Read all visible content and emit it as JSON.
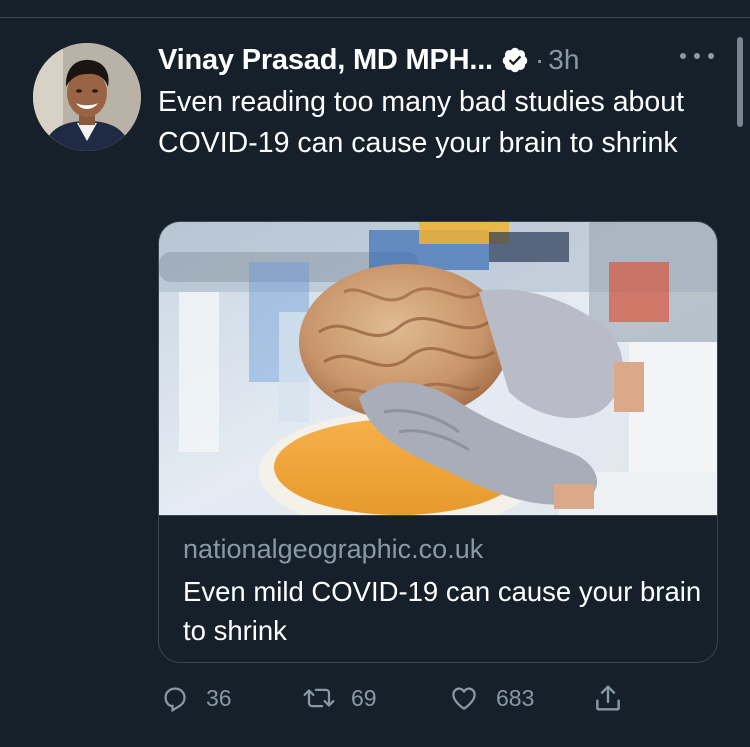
{
  "tweet": {
    "author": {
      "name": "Vinay Prasad, MD MPH...",
      "verified": true
    },
    "separator": "·",
    "time": "3h",
    "text": "Even reading too many bad studies about COVID-19 can cause your brain to shrink",
    "card": {
      "domain": "nationalgeographic.co.uk",
      "title": "Even mild COVID-19 can cause your brain to shrink"
    },
    "actions": {
      "replies": "36",
      "retweets": "69",
      "likes": "683"
    }
  },
  "icons": {
    "verified": "verified-badge-icon",
    "more": "more-horizontal-icon",
    "reply": "reply-icon",
    "retweet": "retweet-icon",
    "like": "heart-icon",
    "share": "share-icon"
  },
  "colors": {
    "background": "#15202b",
    "text": "#ffffff",
    "secondary": "#8899a6",
    "border": "#38444d"
  }
}
